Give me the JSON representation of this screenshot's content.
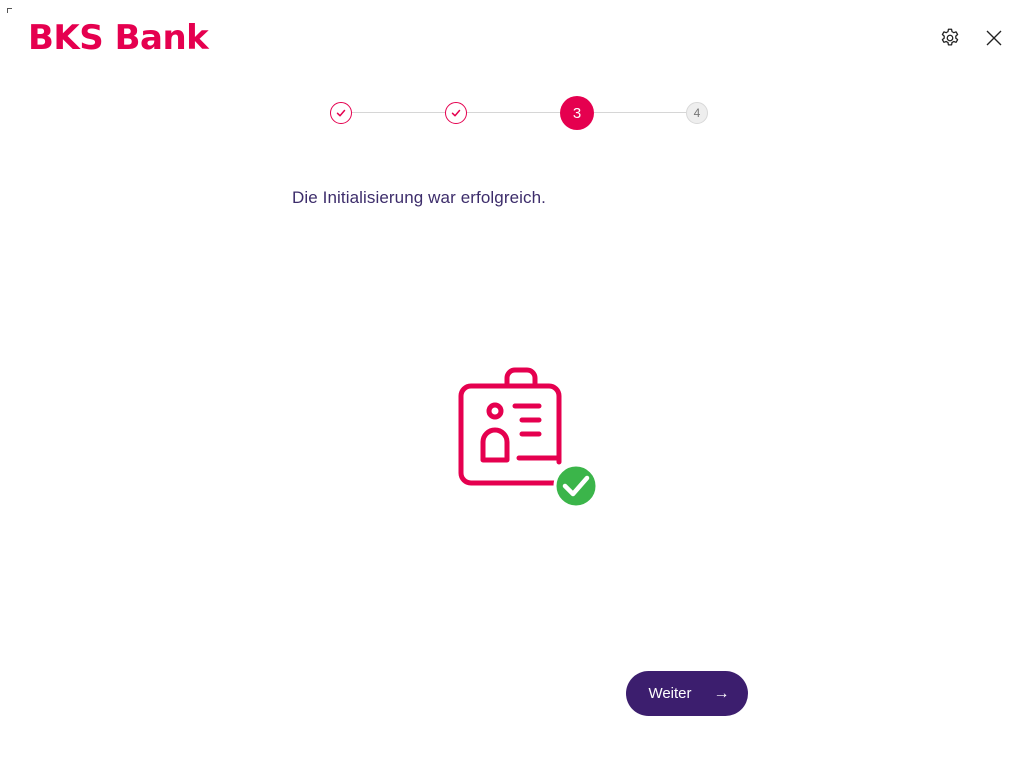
{
  "brand": {
    "name": "BKS Bank",
    "color": "#e5004f"
  },
  "header": {
    "settings_icon": "gear-icon",
    "close_icon": "close-icon"
  },
  "stepper": {
    "current_step": 3,
    "total_steps": 4,
    "steps": [
      {
        "state": "completed",
        "icon": "check-icon"
      },
      {
        "state": "completed",
        "icon": "check-icon"
      },
      {
        "state": "active",
        "label": "3"
      },
      {
        "state": "pending",
        "label": "4"
      }
    ]
  },
  "main": {
    "message": "Die Initialisierung war erfolgreich.",
    "illustration_icon": "id-card-success-icon",
    "success_badge_color": "#3bb54a"
  },
  "footer": {
    "next_label": "Weiter",
    "next_icon": "arrow-right-icon",
    "button_color": "#3c1e6e"
  }
}
